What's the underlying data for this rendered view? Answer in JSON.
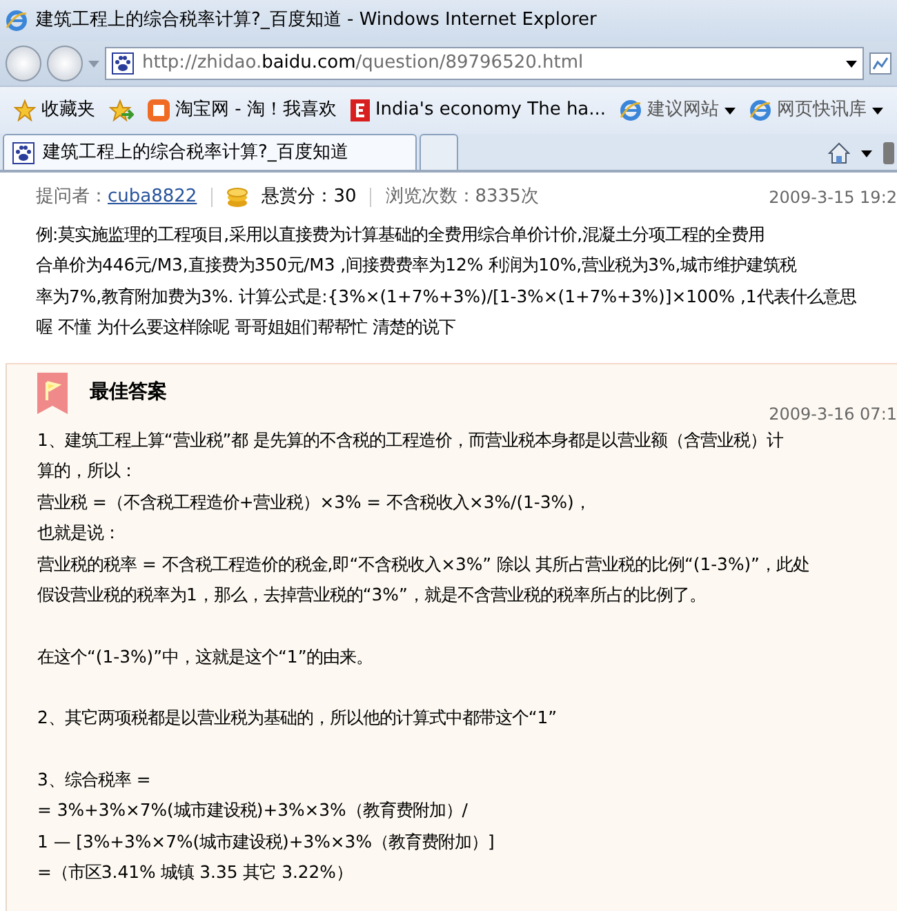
{
  "window": {
    "title": "建筑工程上的综合税率计算?_百度知道 - Windows Internet Explorer"
  },
  "address_bar": {
    "url_prefix": "http://zhidao.",
    "url_domain": "baidu.com",
    "url_path": "/question/89796520.html"
  },
  "favorites_bar": {
    "favorites_label": "收藏夹",
    "links": [
      {
        "kind": "taobao",
        "label": "淘宝网 - 淘！我喜欢",
        "dropdown": false
      },
      {
        "kind": "economist",
        "label": "India's economy The ha...",
        "dropdown": false
      },
      {
        "kind": "ie",
        "label": "建议网站",
        "dropdown": true
      },
      {
        "kind": "ie",
        "label": "网页快讯库",
        "dropdown": true
      }
    ]
  },
  "tabs": [
    {
      "label": "建筑工程上的综合税率计算?_百度知道",
      "selected": true
    }
  ],
  "question": {
    "asker_label": "提问者：",
    "asker": "cuba8822",
    "reward": "悬赏分：30",
    "views": "浏览次数：8335次",
    "date": "2009-3-15 19:2",
    "lines": [
      "例:莫实施监理的工程项目,采用以直接费为计算基础的全费用综合单价计价,混凝土分项工程的全费用",
      "合单价为446元/M3,直接费为350元/M3 ,间接费费率为12% 利润为10%,营业税为3%,城市维护建筑税",
      "率为7%,教育附加费为3%. 计算公式是:{3%×(1+7%+3%)/[1-3%×(1+7%+3%)]×100% ,1代表什么意思",
      "喔  不懂  为什么要这样除呢  哥哥姐姐们帮帮忙 清楚的说下"
    ]
  },
  "best_answer": {
    "title": "最佳答案",
    "date": "2009-3-16 07:1",
    "paragraphs": [
      [
        "1、建筑工程上算“营业税”都 是先算的不含税的工程造价，而营业税本身都是以营业额（含营业税）计",
        "算的，所以：",
        "营业税 =（不含税工程造价+营业税）×3% = 不含税收入×3%/(1-3%)，",
        "也就是说：",
        "营业税的税率 = 不含税工程造价的税金,即“不含税收入×3%” 除以 其所占营业税的比例“(1-3%)”，此处",
        "假设营业税的税率为1，那么，去掉营业税的“3%”，就是不含营业税的税率所占的比例了。"
      ],
      [
        "在这个“(1-3%)”中，这就是这个“1”的由来。"
      ],
      [
        "2、其它两项税都是以营业税为基础的，所以他的计算式中都带这个“1”"
      ],
      [
        "3、综合税率 =",
        "= 3%+3%×7%(城市建设税)+3%×3%（教育费附加）/",
        "1 — [3%+3%×7%(城市建设税)+3%×3%（教育费附加）]",
        "=（市区3.41% 城镇 3.35 其它 3.22%）"
      ]
    ]
  }
}
